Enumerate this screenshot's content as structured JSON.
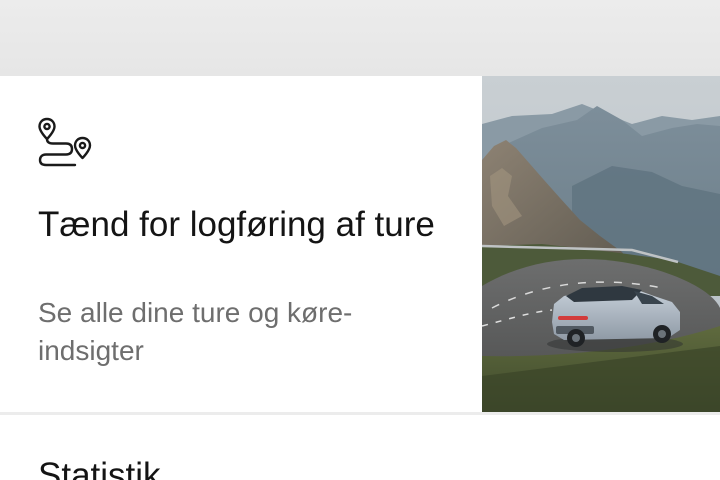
{
  "trip_logging_card": {
    "icon": "route-pins-icon",
    "title": "Tænd for logføring af ture",
    "subtitle": "Se alle dine ture og køre-indsigter",
    "image": "car-on-mountain-road"
  },
  "statistics_section": {
    "title": "Statistik"
  },
  "colors": {
    "top_bar": "#e9e9e9",
    "title_text": "#141414",
    "subtitle_text": "#6e6e6e",
    "divider": "#ececec"
  }
}
